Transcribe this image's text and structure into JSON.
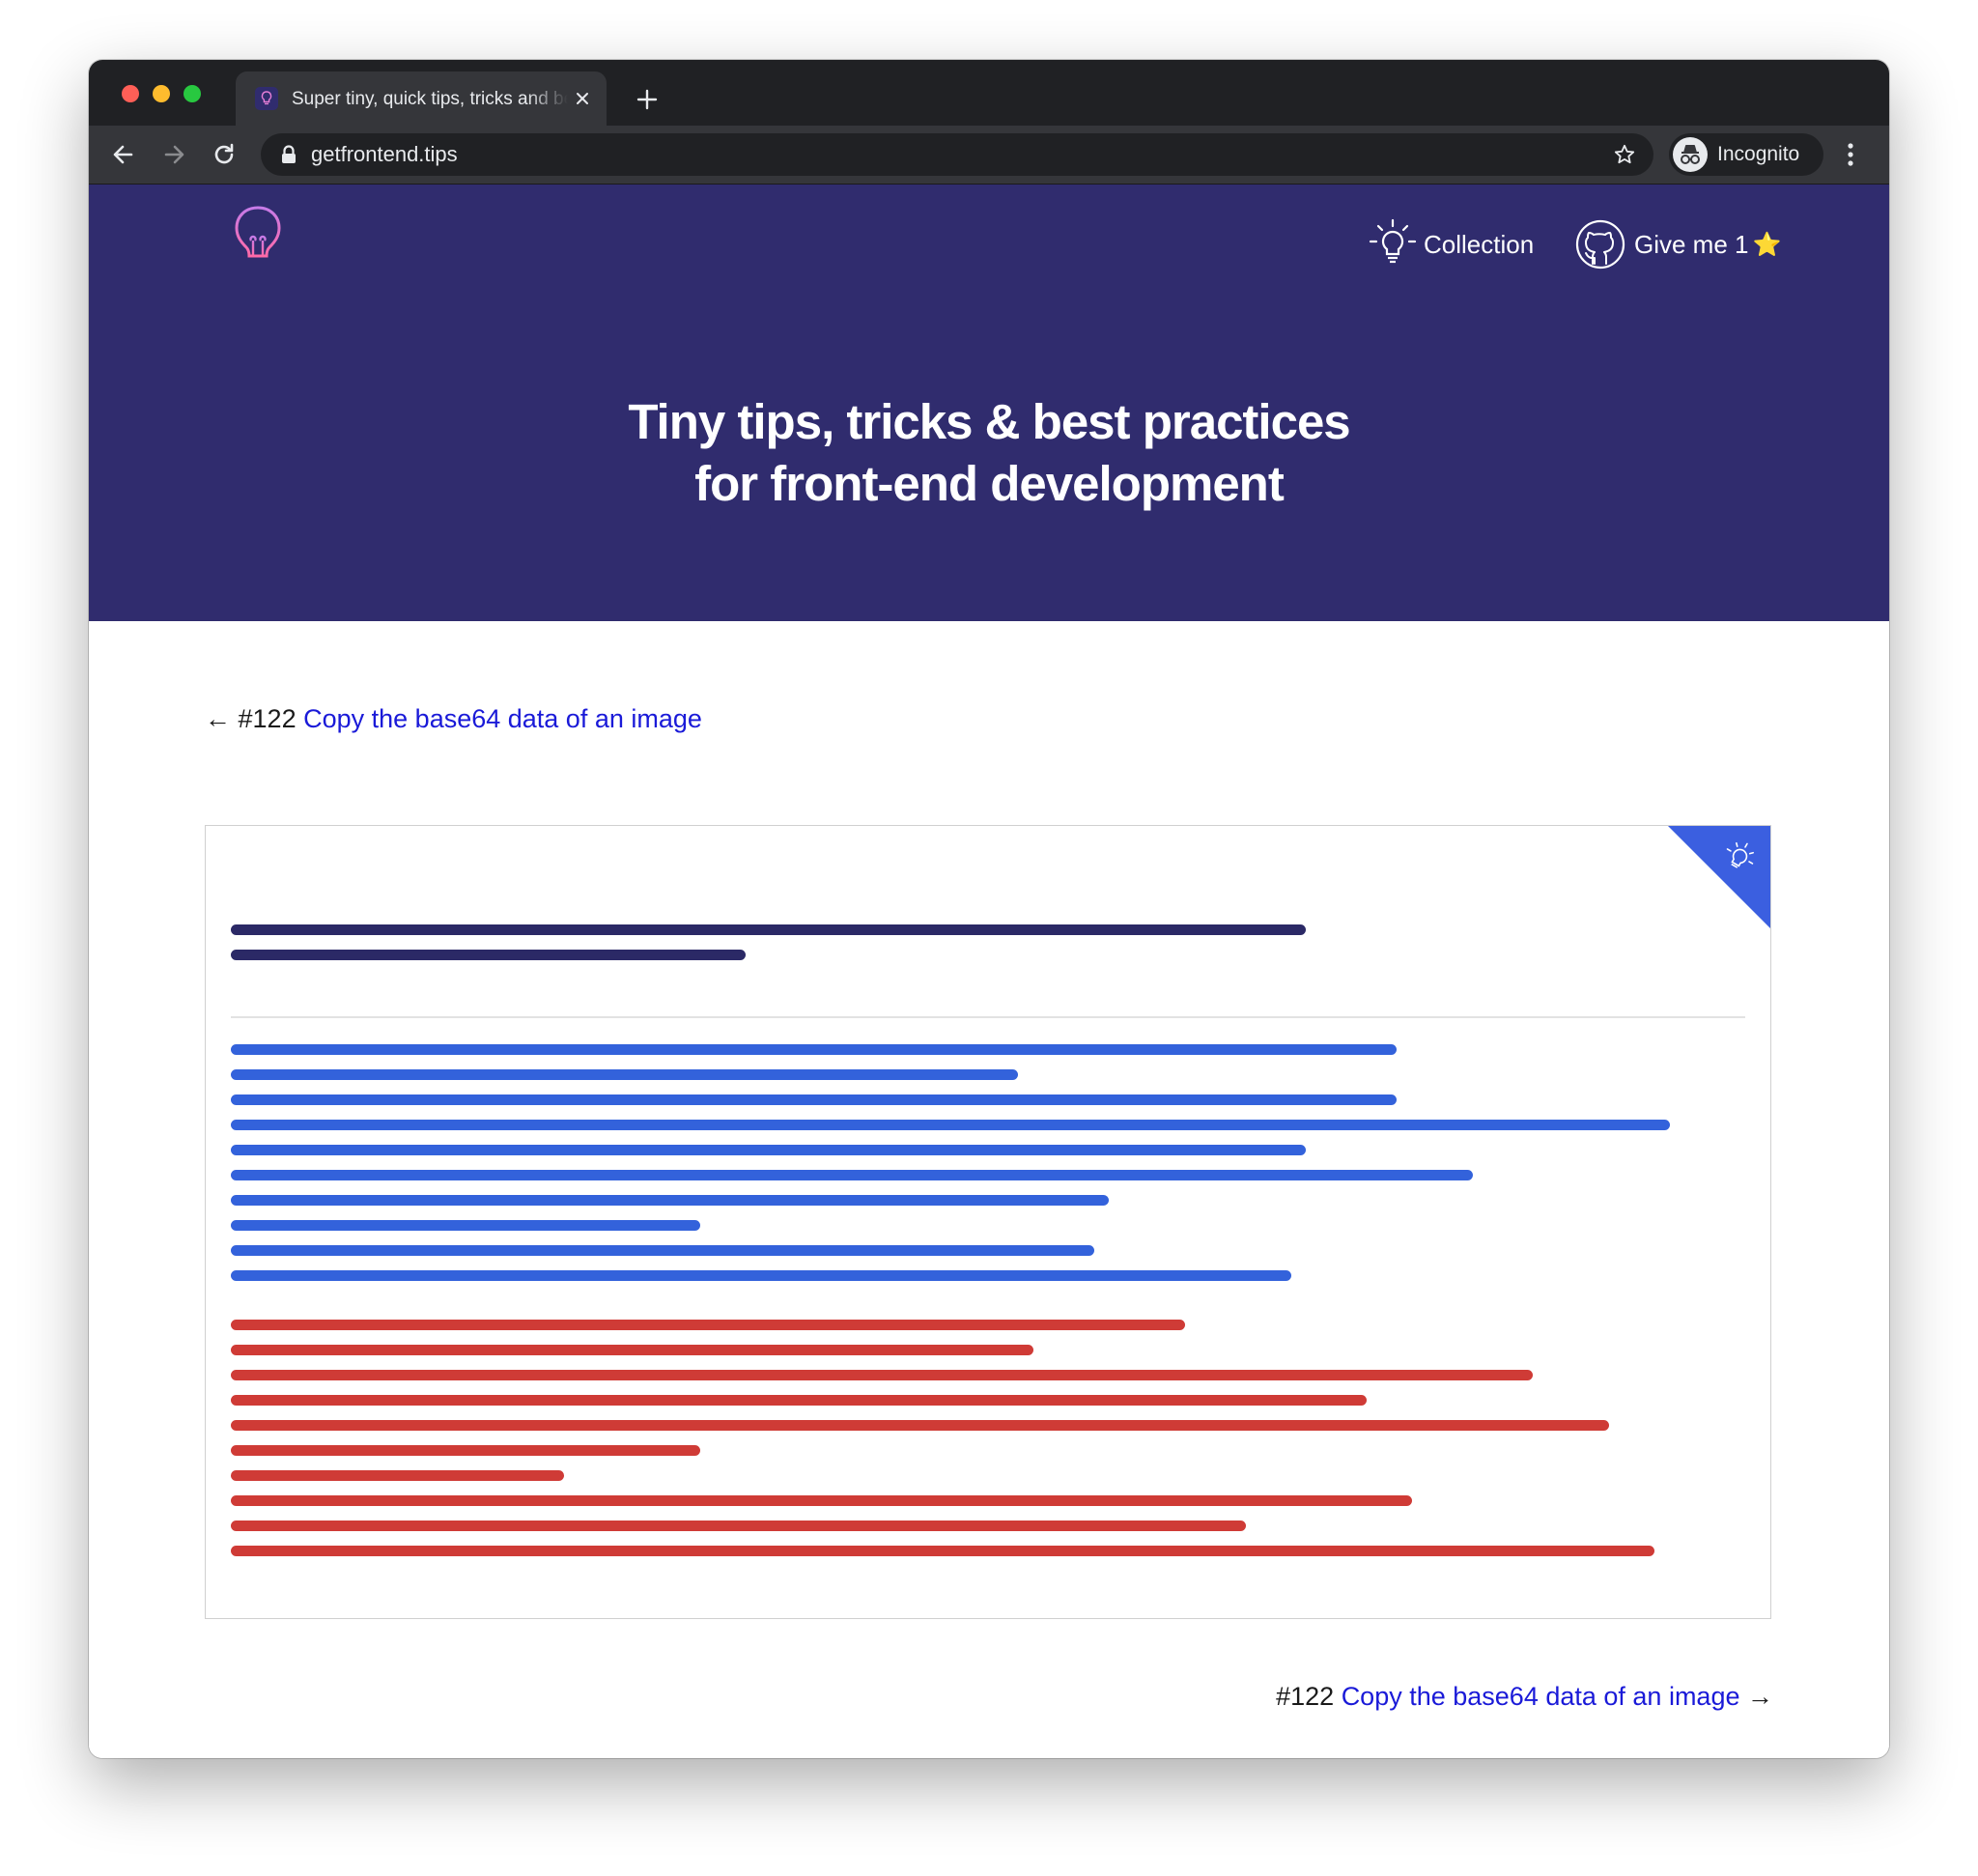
{
  "browser": {
    "tab_title": "Super tiny, quick tips, tricks and best practices for front-end development",
    "url": "getfrontend.tips",
    "profile_label": "Incognito",
    "icons": [
      "back-icon",
      "forward-icon",
      "reload-icon",
      "lock-icon",
      "bookmark-star-icon",
      "incognito-icon",
      "kebab-menu-icon",
      "close-icon",
      "plus-icon"
    ]
  },
  "header": {
    "logo_icon": "lightbulb-icon",
    "nav": {
      "collection_label": "Collection",
      "github_label": "Give me 1",
      "github_emoji": "⭐"
    }
  },
  "hero": {
    "title_line1": "Tiny tips, tricks & best practices",
    "title_line2": "for front-end development"
  },
  "prev_tip": {
    "arrow": "←",
    "number": "#122",
    "title": "Copy the base64 data of an image"
  },
  "next_tip": {
    "arrow": "→",
    "number": "#122",
    "title": "Copy the base64 data of an image"
  },
  "placeholder_card": {
    "corner_icon": "lightbulb-icon",
    "title_lines": [
      0.71,
      0.34
    ],
    "blue_lines": [
      0.77,
      0.52,
      0.77,
      0.95,
      0.71,
      0.82,
      0.58,
      0.31,
      0.57,
      0.7
    ],
    "red_lines": [
      0.63,
      0.53,
      0.86,
      0.75,
      0.91,
      0.31,
      0.22,
      0.78,
      0.67,
      0.94
    ]
  },
  "colors": {
    "hero_background": "#302c6e",
    "link": "#1a1ad8",
    "title_bar": "#2b2966",
    "blue_bar": "#3362db",
    "red_bar": "#cf3b36",
    "corner_badge": "#3b5fe0"
  }
}
